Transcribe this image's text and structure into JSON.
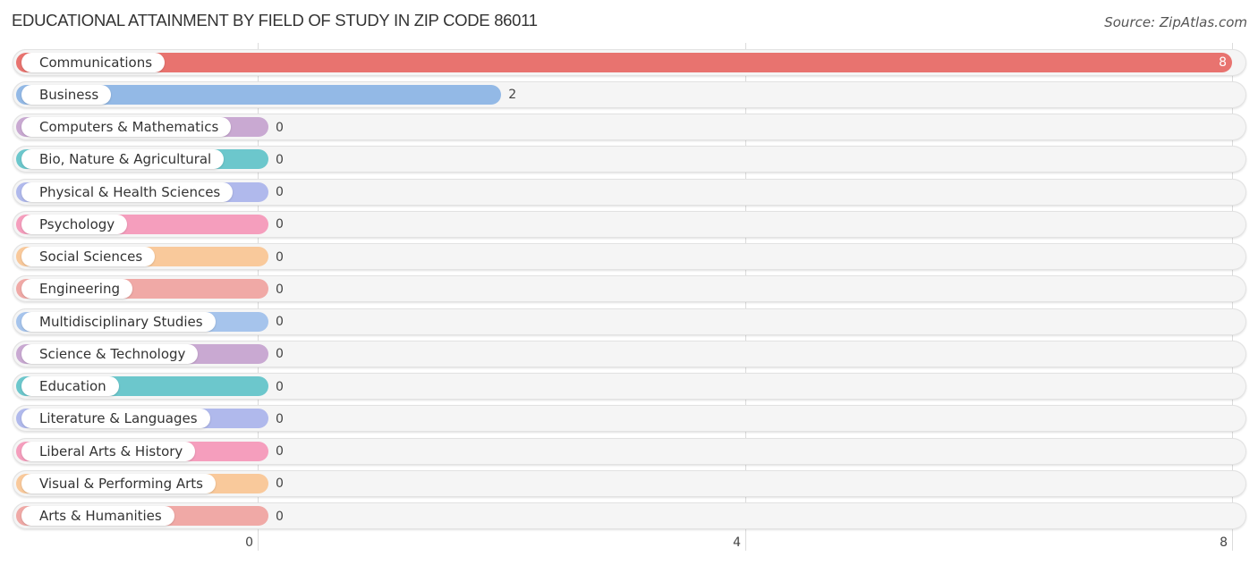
{
  "title": "EDUCATIONAL ATTAINMENT BY FIELD OF STUDY IN ZIP CODE 86011",
  "source": "Source: ZipAtlas.com",
  "chart_data": {
    "type": "bar",
    "orientation": "horizontal",
    "title": "EDUCATIONAL ATTAINMENT BY FIELD OF STUDY IN ZIP CODE 86011",
    "xlabel": "",
    "ylabel": "",
    "xlim": [
      0,
      8
    ],
    "xticks": [
      0,
      4,
      8
    ],
    "grid": true,
    "categories": [
      "Communications",
      "Business",
      "Computers & Mathematics",
      "Bio, Nature & Agricultural",
      "Physical & Health Sciences",
      "Psychology",
      "Social Sciences",
      "Engineering",
      "Multidisciplinary Studies",
      "Science & Technology",
      "Education",
      "Literature & Languages",
      "Liberal Arts & History",
      "Visual & Performing Arts",
      "Arts & Humanities"
    ],
    "values": [
      8,
      2,
      0,
      0,
      0,
      0,
      0,
      0,
      0,
      0,
      0,
      0,
      0,
      0,
      0
    ],
    "colors": [
      "#e8736f",
      "#93b9e6",
      "#c9a9d2",
      "#6cc7cc",
      "#b0b9ec",
      "#f59ebd",
      "#f9c99b",
      "#f0a9a6",
      "#a6c4ec",
      "#c9a9d2",
      "#6cc7cc",
      "#b0b9ec",
      "#f59ebd",
      "#f9c99b",
      "#f0a9a6"
    ]
  }
}
